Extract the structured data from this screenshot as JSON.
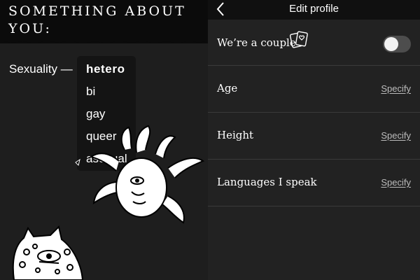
{
  "left_panel": {
    "title_line1": "SOMETHING ABOUT",
    "title_line2": "YOU:",
    "sexuality_label": "Sexuality —",
    "sexuality_options": [
      "hetero",
      "bi",
      "gay",
      "queer",
      "asexual"
    ],
    "selected_option": "hetero"
  },
  "right_panel": {
    "nav_title": "Edit profile",
    "couple_row": {
      "label": "We’re a couple",
      "toggle_on": false
    },
    "rows": [
      {
        "label": "Age",
        "action": "Specify"
      },
      {
        "label": "Height",
        "action": "Specify"
      },
      {
        "label": "Languages I speak",
        "action": "Specify"
      }
    ]
  },
  "colors": {
    "background": "#1c1c1c",
    "header_black": "#0b0b0b",
    "menu_bg": "#141414",
    "text": "#ffffff",
    "specify_text": "#bdbdbd",
    "divider": "#3a3a3a",
    "toggle_track": "#4d4d4d"
  },
  "icons": [
    "chevron-left-icon",
    "playing-cards-heart-icon"
  ]
}
